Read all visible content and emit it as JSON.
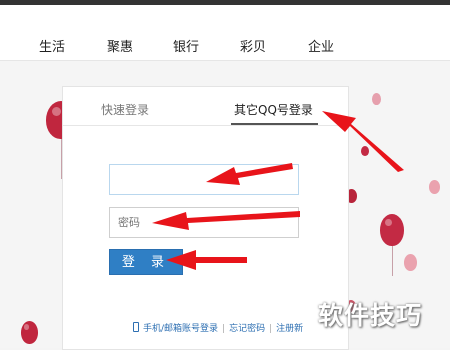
{
  "nav": {
    "items": [
      "生活",
      "聚惠",
      "银行",
      "彩贝",
      "企业"
    ]
  },
  "login": {
    "tabs": [
      "快速登录",
      "其它QQ号登录"
    ],
    "account_placeholder": "",
    "password_placeholder": "密码",
    "submit_label": "登 录",
    "links": {
      "phone_login": "手机/邮箱账号登录",
      "forgot_password": "忘记密码",
      "register": "注册新"
    }
  },
  "watermark": "软件技巧",
  "colors": {
    "accent_blue": "#2f7fc5",
    "annotation_red": "#e8141a",
    "balloon_red": "#c0263e"
  }
}
